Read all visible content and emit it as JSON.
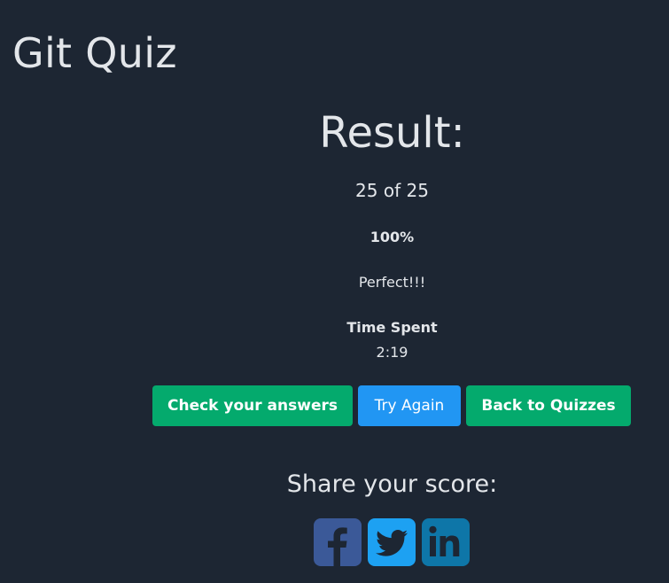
{
  "header": {
    "title": "Git Quiz"
  },
  "result": {
    "heading": "Result:",
    "score": "25 of 25",
    "percent": "100%",
    "verdict": "Perfect!!!",
    "time_label": "Time Spent",
    "time_value": "2:19"
  },
  "actions": {
    "check_label": "Check your answers",
    "try_again_label": "Try Again",
    "back_label": "Back to Quizzes"
  },
  "share": {
    "label": "Share your score:",
    "icons": [
      "facebook-icon",
      "twitter-icon",
      "linkedin-icon"
    ]
  },
  "colors": {
    "background": "#1d2633",
    "green": "#04aa6d",
    "blue": "#2196f3",
    "facebook": "#3b5998",
    "twitter": "#1da1f2",
    "linkedin": "#0e76a8"
  }
}
